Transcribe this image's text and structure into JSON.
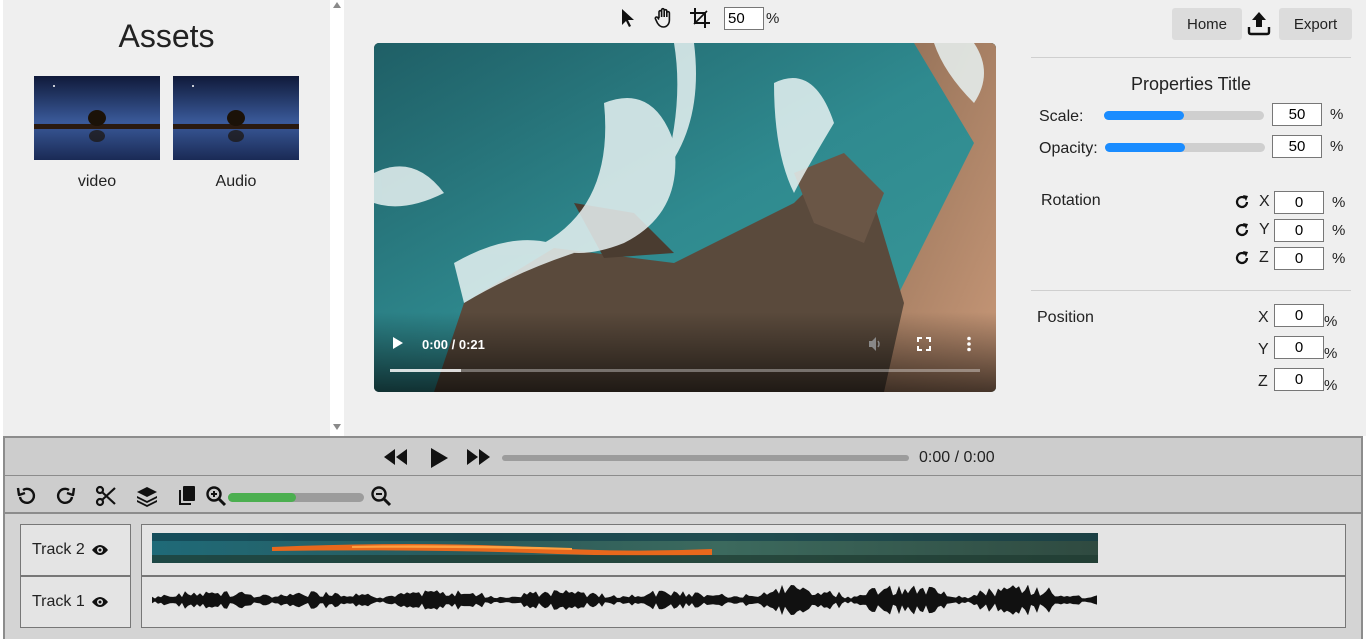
{
  "assets": {
    "title": "Assets",
    "items": [
      {
        "label": "video"
      },
      {
        "label": "Audio"
      }
    ]
  },
  "toolbar": {
    "icons": [
      "pointer-icon",
      "hand-icon",
      "crop-icon"
    ],
    "zoom_value": "50",
    "zoom_unit": "%"
  },
  "player": {
    "time": "0:00 / 0:21",
    "buffered_fraction": 0.12
  },
  "header": {
    "home_label": "Home",
    "export_label": "Export"
  },
  "properties": {
    "title": "Properties Title",
    "scale": {
      "label": "Scale:",
      "value": "50",
      "unit": "%",
      "fill_fraction": 0.5
    },
    "opacity": {
      "label": "Opacity:",
      "value": "50",
      "unit": "%",
      "fill_fraction": 0.5
    },
    "rotation": {
      "label": "Rotation",
      "axes": [
        {
          "axis": "X",
          "value": "0",
          "unit": "%"
        },
        {
          "axis": "Y",
          "value": "0",
          "unit": "%"
        },
        {
          "axis": "Z",
          "value": "0",
          "unit": "%"
        }
      ]
    },
    "position": {
      "label": "Position",
      "axes": [
        {
          "axis": "X",
          "value": "0",
          "unit": "%"
        },
        {
          "axis": "Y",
          "value": "0",
          "unit": "%"
        },
        {
          "axis": "Z",
          "value": "0",
          "unit": "%"
        }
      ]
    }
  },
  "transport": {
    "time": "0:00 / 0:00"
  },
  "edit": {
    "zoom_fraction": 0.5
  },
  "timeline": {
    "tracks": [
      {
        "label": "Track 2",
        "type": "video"
      },
      {
        "label": "Track 1",
        "type": "audio"
      }
    ]
  },
  "colors": {
    "accent_blue": "#1a8cff",
    "zoom_green": "#4caf50",
    "panel_bg": "#efefef",
    "timeline_bg": "#d4d4d4"
  }
}
